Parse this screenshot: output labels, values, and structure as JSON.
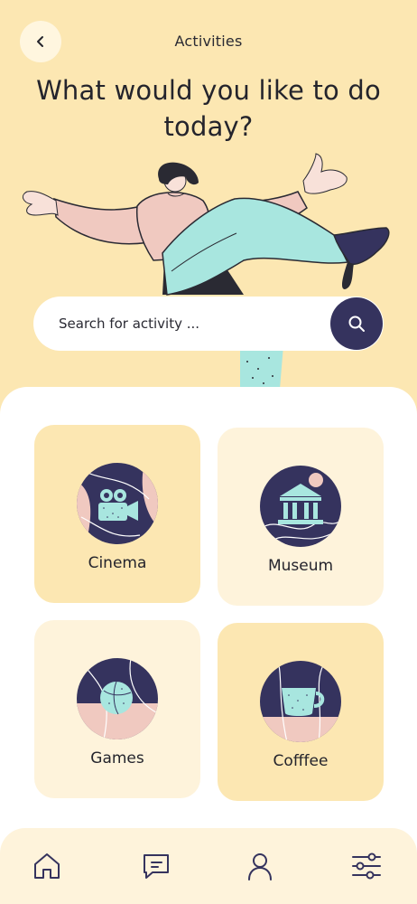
{
  "header": {
    "title": "Activities",
    "back_icon": "chevron-left-icon"
  },
  "hero": {
    "title": "What would you like to do today?"
  },
  "search": {
    "placeholder": "Search for activity ...",
    "button_icon": "search-icon"
  },
  "activities": [
    {
      "label": "Cinema",
      "icon": "camera-icon",
      "style": "dark"
    },
    {
      "label": "Museum",
      "icon": "museum-icon",
      "style": "light"
    },
    {
      "label": "Games",
      "icon": "ball-icon",
      "style": "light"
    },
    {
      "label": "Cofffee",
      "icon": "coffee-cup-icon",
      "style": "dark"
    }
  ],
  "bottom_nav": [
    {
      "icon": "home-icon"
    },
    {
      "icon": "chat-icon"
    },
    {
      "icon": "profile-icon"
    },
    {
      "icon": "filter-icon"
    }
  ],
  "colors": {
    "background": "#FCE7B2",
    "card_dark": "#FCE7B2",
    "card_light": "#FEF3DB",
    "accent_navy": "#35335E",
    "accent_mint": "#A8E6DF",
    "accent_pink": "#F0C9C0"
  }
}
